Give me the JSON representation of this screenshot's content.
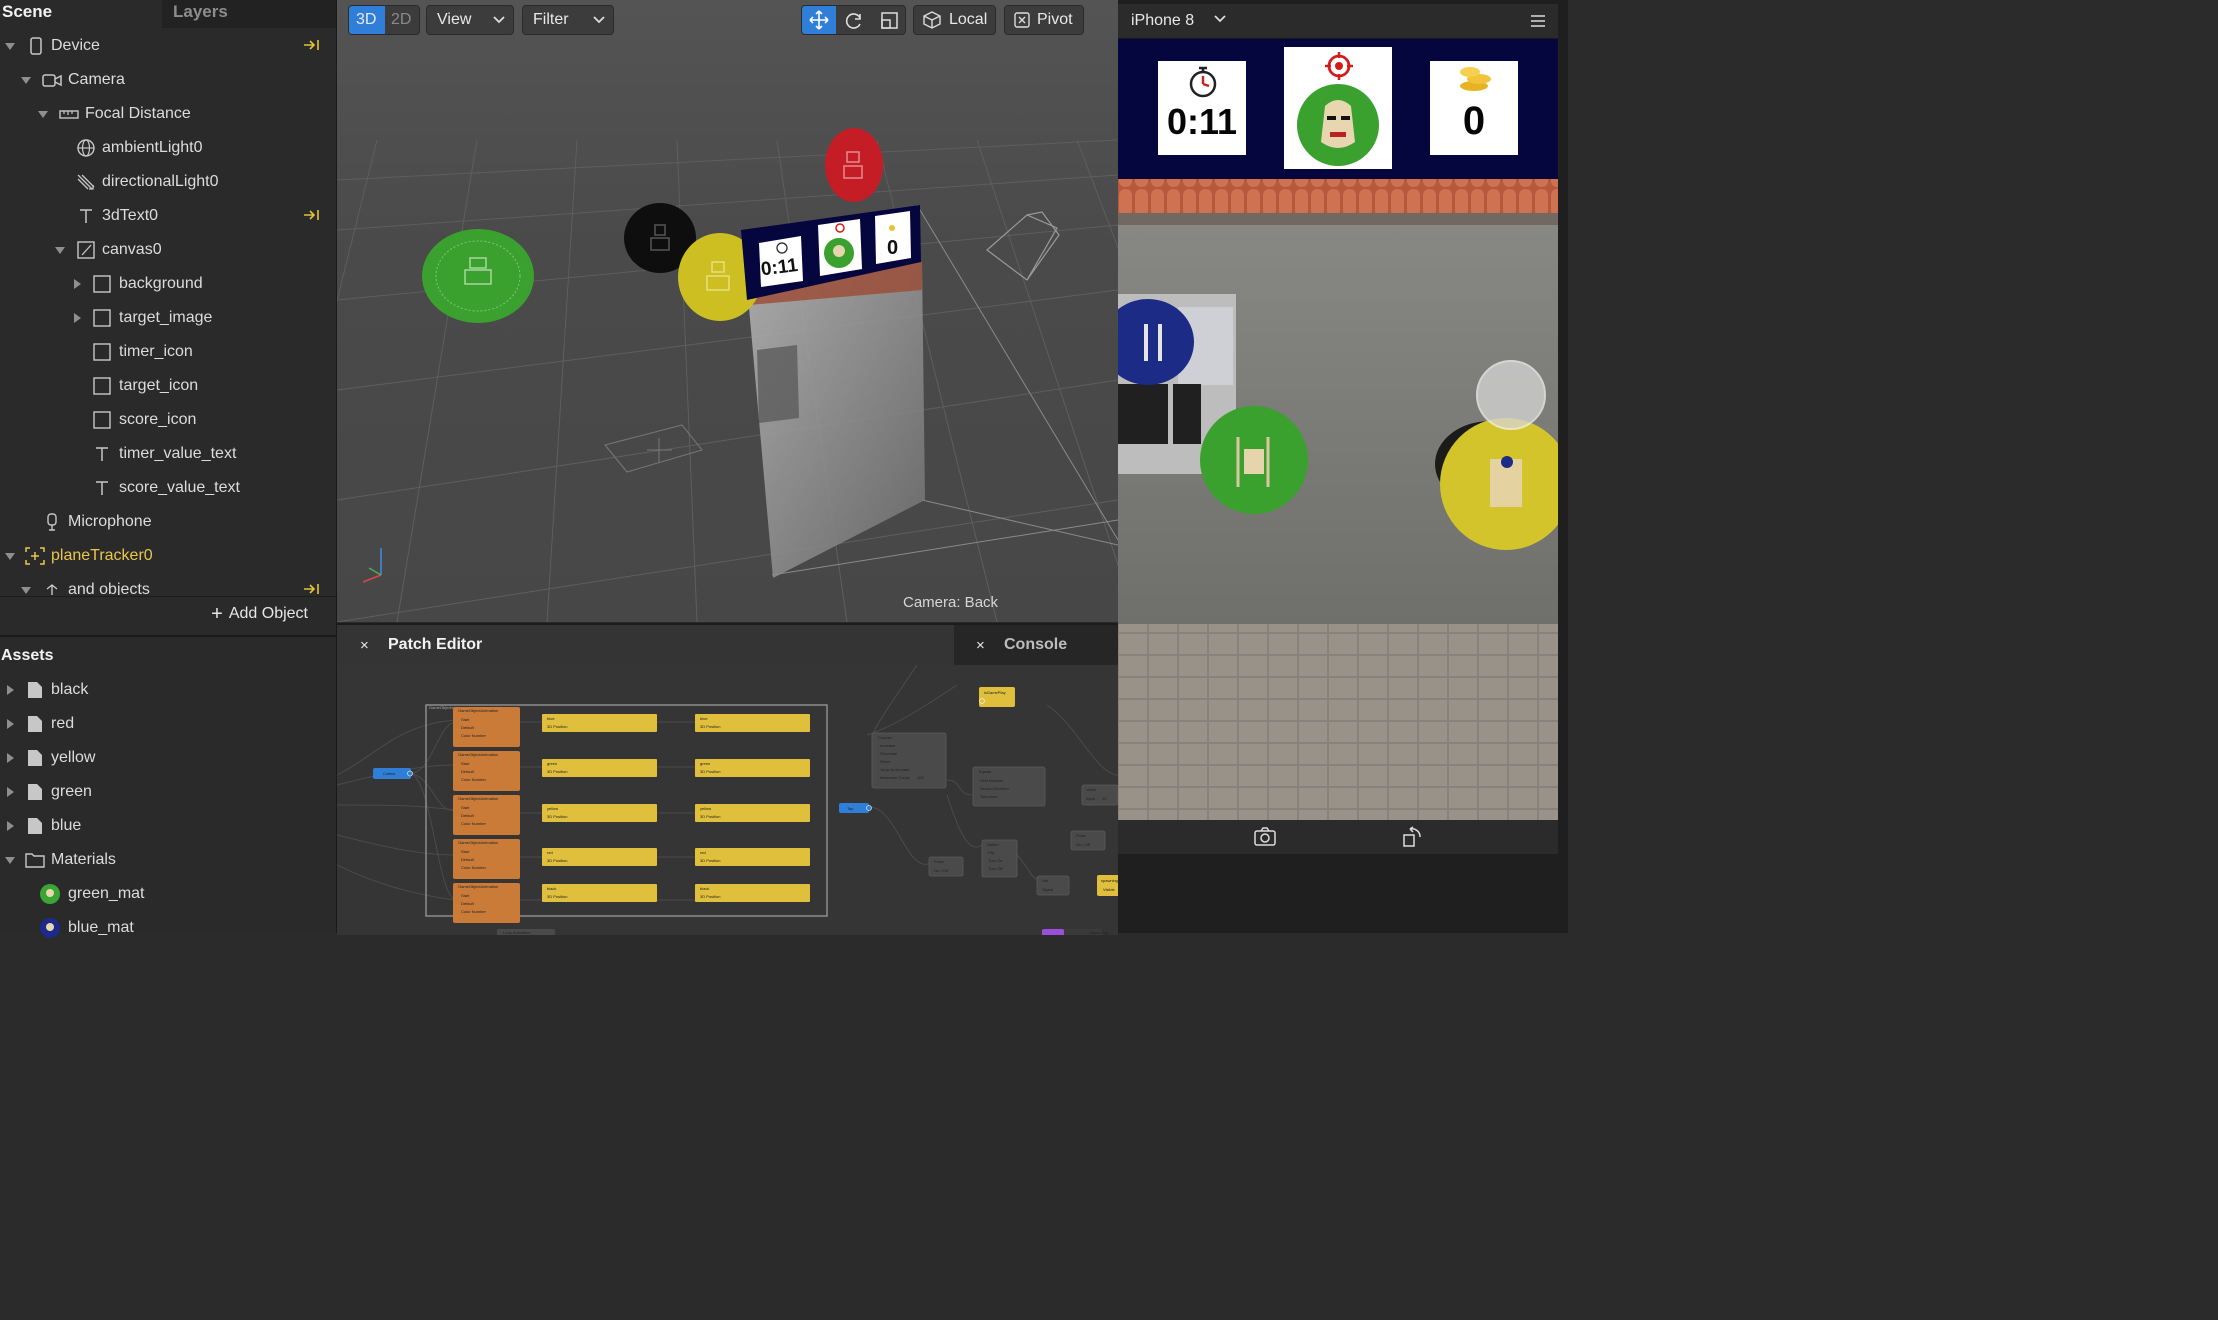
{
  "scene_panel": {
    "tabs": [
      "Scene",
      "Layers"
    ],
    "tree": [
      {
        "label": "Device",
        "icon": "phone-icon",
        "expanded": true,
        "pinned": true,
        "depth": 0
      },
      {
        "label": "Camera",
        "icon": "camera-icon",
        "expanded": true,
        "depth": 1
      },
      {
        "label": "Focal Distance",
        "icon": "ruler-icon",
        "expanded": true,
        "depth": 2
      },
      {
        "label": "ambientLight0",
        "icon": "globe-icon",
        "depth": 3
      },
      {
        "label": "directionalLight0",
        "icon": "directional-light-icon",
        "depth": 3
      },
      {
        "label": "3dText0",
        "icon": "text-icon",
        "pinned": true,
        "depth": 3
      },
      {
        "label": "canvas0",
        "icon": "canvas-icon",
        "expanded": true,
        "depth": 3
      },
      {
        "label": "background",
        "icon": "rectangle-icon",
        "collapsed": true,
        "depth": 4
      },
      {
        "label": "target_image",
        "icon": "rectangle-icon",
        "collapsed": true,
        "depth": 4
      },
      {
        "label": "timer_icon",
        "icon": "rectangle-icon",
        "depth": 4
      },
      {
        "label": "target_icon",
        "icon": "rectangle-icon",
        "depth": 4
      },
      {
        "label": "score_icon",
        "icon": "rectangle-icon",
        "depth": 4
      },
      {
        "label": "timer_value_text",
        "icon": "text-icon",
        "depth": 4
      },
      {
        "label": "score_value_text",
        "icon": "text-icon",
        "depth": 4
      },
      {
        "label": "Microphone",
        "icon": "microphone-icon",
        "depth": 2
      },
      {
        "label": "planeTracker0",
        "icon": "plane-tracker-icon",
        "expanded": true,
        "depth": 0,
        "highlight": "#e9c74a"
      },
      {
        "label": "and objects",
        "icon": "null-object-icon",
        "depth": 1,
        "pinned": true
      }
    ],
    "add_object": "Add Object",
    "assets_title": "Assets",
    "assets": [
      {
        "label": "black",
        "icon": "file-icon"
      },
      {
        "label": "red",
        "icon": "file-icon"
      },
      {
        "label": "yellow",
        "icon": "file-icon"
      },
      {
        "label": "green",
        "icon": "file-icon"
      },
      {
        "label": "blue",
        "icon": "file-icon"
      },
      {
        "label": "Materials",
        "icon": "folder-icon",
        "expanded": true
      },
      {
        "label": "green_mat",
        "icon": "material-icon"
      },
      {
        "label": "blue_mat",
        "icon": "material-icon"
      }
    ]
  },
  "viewport": {
    "mode_3d": "3D",
    "mode_2d": "2D",
    "view_menu": "View",
    "filter_menu": "Filter",
    "local_button": "Local",
    "pivot_button": "Pivot",
    "camera_label": "Camera: Back",
    "overlay_timer": "0:11",
    "overlay_score": "0",
    "colors": {
      "accent": "#2f7fd8",
      "green": "#39a335",
      "yellow": "#cfc12a",
      "red": "#c8202a",
      "black": "#121212"
    }
  },
  "simulator": {
    "device": "iPhone 8",
    "timer_value": "0:11",
    "score_value": "0",
    "hud_color": "#05063d"
  },
  "bottom_panel": {
    "patch_tab": "Patch Editor",
    "console_tab": "Console",
    "close": "×",
    "patches": {
      "group": "GameObjects",
      "rows": [
        "blue",
        "green",
        "yellow",
        "red",
        "black"
      ],
      "anim_title": "GameObjectAnimation",
      "position_label": "3D Position",
      "left_inputs": [
        "Start",
        "Default",
        "Color Number"
      ],
      "counter_title": "Counter",
      "counter_ports": [
        "Increase",
        "Decrease",
        "Reset",
        "Jump to Number",
        "Maximum Count"
      ],
      "counter_max": "100",
      "equals_title": "Equals",
      "equals_ports": [
        "First Number",
        "Second Number",
        "Tolerance"
      ],
      "switch_title": "Switch",
      "switch_ports": [
        "Flip",
        "Turn On",
        "Turn Off"
      ],
      "pulse_title": "Pulse",
      "pulse_port": "On / Off",
      "not_title": "Not",
      "not_port": "Signal",
      "value_title": "Value",
      "value_port": "Input",
      "value_input": "10",
      "is_game_play": "isGamePlay",
      "spawning": "spawningObjects",
      "loop_anim": "Loop Animation",
      "object_tap": "Object Tap",
      "collect": "Collect",
      "tap": "Tap",
      "visible_port": "Visible",
      "zero": "0"
    }
  }
}
